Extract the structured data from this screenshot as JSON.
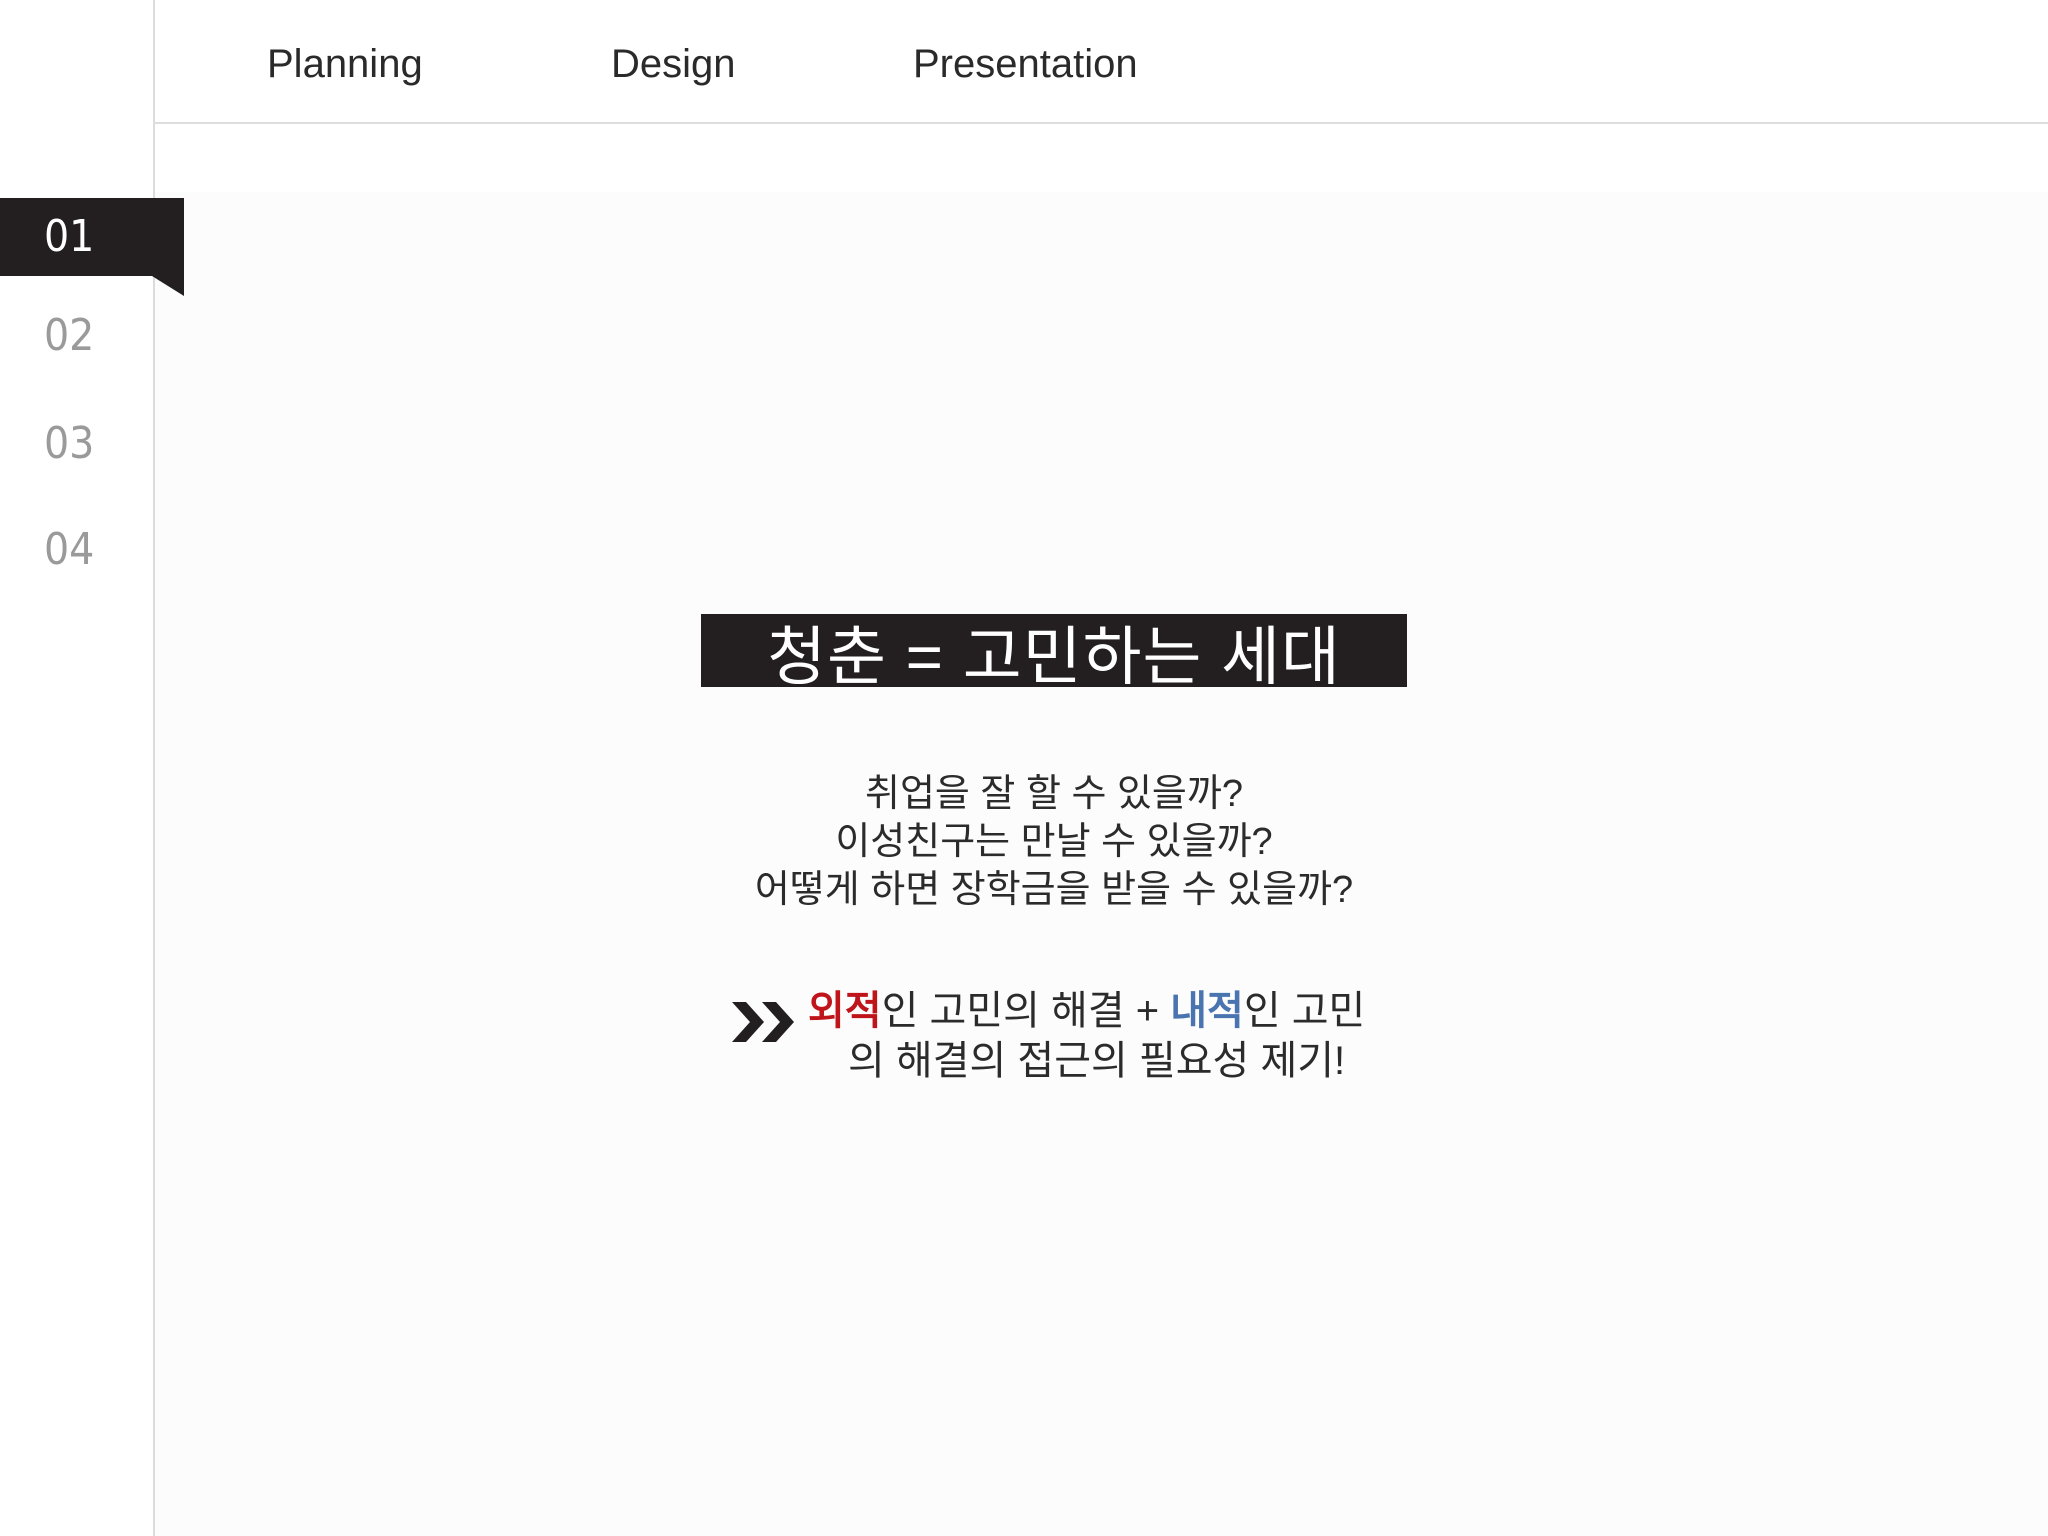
{
  "nav": {
    "tabs": [
      {
        "label": "Planning"
      },
      {
        "label": "Design"
      },
      {
        "label": "Presentation"
      }
    ]
  },
  "sidebar": {
    "steps": [
      {
        "label": "01",
        "active": true
      },
      {
        "label": "02",
        "active": false
      },
      {
        "label": "03",
        "active": false
      },
      {
        "label": "04",
        "active": false
      }
    ]
  },
  "slide": {
    "title": "청춘 = 고민하는 세대",
    "questions": [
      "취업을 잘 할 수 있을까?",
      "이성친구는 만날 수 있을까?",
      "어떻게 하면 장학금을 받을 수 있을까?"
    ],
    "conclusion": {
      "arrow_icon": "double-chevron-right-icon",
      "highlight_outer": "외적",
      "text_1": "인 고민의 해결 + ",
      "highlight_inner": "내적",
      "text_2": "인 고민",
      "line_2": "의 해결의 접근의 필요성 제기!"
    }
  },
  "colors": {
    "accent_dark": "#231f20",
    "outer_red": "#c0141b",
    "inner_blue": "#4a74b0",
    "inactive_step": "#9a9a9a"
  }
}
